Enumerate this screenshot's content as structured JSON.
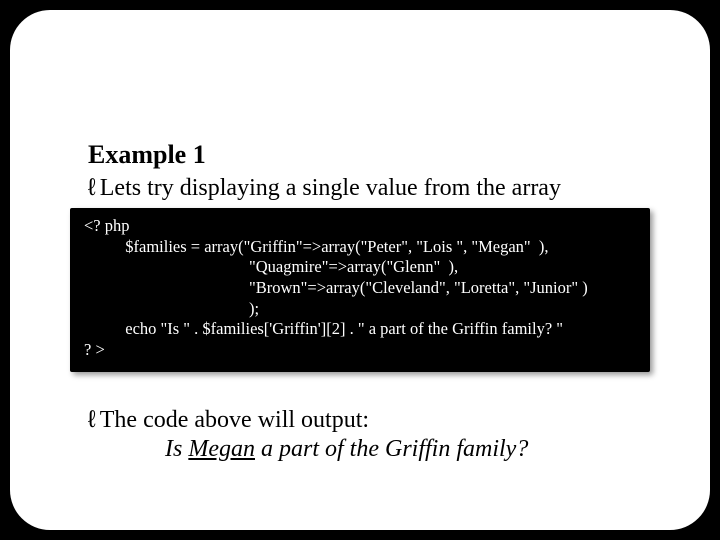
{
  "title": "Example 1",
  "bullet": "ℓ",
  "lead": "Lets try displaying a single value from the array",
  "code": {
    "l1": "<? php",
    "l2": "          $families = array(\"Griffin\"=>array(\"Peter\", \"Lois \", \"Megan\"  ),",
    "l3": "                                        \"Quagmire\"=>array(\"Glenn\"  ),",
    "l4": "                                        \"Brown\"=>array(\"Cleveland\", \"Loretta\", \"Junior\" )",
    "l5": "                                        );",
    "l6": "          echo \"Is \" . $families['Griffin'][2] . \" a part of the Griffin family? \"",
    "l7": "? >"
  },
  "outlead": "The code above will output:",
  "output_prefix": "Is ",
  "output_underlined": "Megan",
  "output_suffix": " a part of the Griffin family?"
}
